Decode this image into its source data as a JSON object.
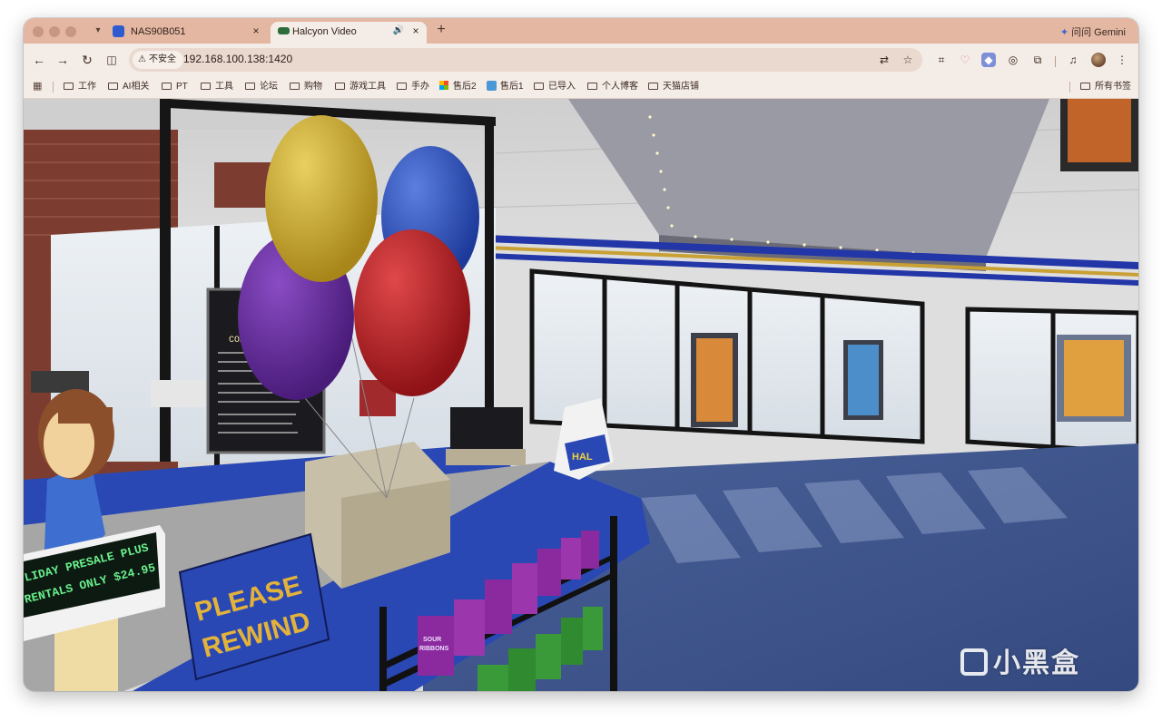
{
  "tabs": [
    {
      "title": "NAS90B051",
      "icon": "nas-favicon-icon",
      "active": false
    },
    {
      "title": "Halcyon Video",
      "icon": "halcyon-favicon-icon",
      "active": true,
      "audio": true
    }
  ],
  "gemini_label": "问问 Gemini",
  "address_bar": {
    "security_label": "不安全",
    "url": "192.168.100.138:1420"
  },
  "bookmarks": [
    "工作",
    "AI相关",
    "PT",
    "工具",
    "论坛",
    "购物",
    "游戏工具",
    "手办",
    "售后2",
    "售后1",
    "已导入",
    "个人博客",
    "天猫店铺"
  ],
  "all_bookmarks_label": "所有书签",
  "scene": {
    "ticker_line1": "LIDAY PRESALE PLUS",
    "ticker_line2": "RENTALS ONLY $24.95",
    "rewind_line1": "PLEASE",
    "rewind_line2": "REWIND",
    "board_heading": "COM",
    "box_label_1": "SOUR",
    "box_label_2": "RIBBONS",
    "bag_label": "HAL"
  },
  "watermark": "小黑盒",
  "colors": {
    "tabstrip": "#e3b7a2",
    "toolbar": "#f4ece6",
    "counter_blue": "#2a48b4",
    "carpet": "#3d5590",
    "stripe_gold": "#c9a033"
  }
}
